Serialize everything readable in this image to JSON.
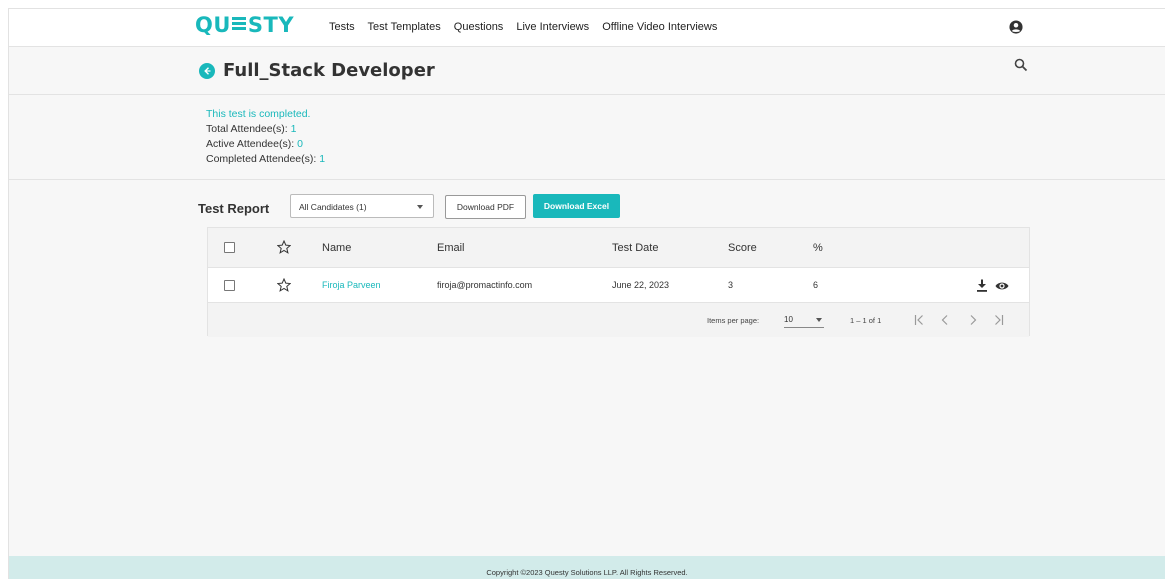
{
  "brand": {
    "logo_left": "QU",
    "logo_right": "STY",
    "accent": "#19b8bb"
  },
  "nav": {
    "items": [
      {
        "label": "Tests"
      },
      {
        "label": "Test Templates"
      },
      {
        "label": "Questions"
      },
      {
        "label": "Live Interviews"
      },
      {
        "label": "Offline Video Interviews"
      }
    ],
    "user_icon": "user-circle-icon"
  },
  "page": {
    "title": "Full_Stack Developer",
    "back_icon": "back-arrow-icon",
    "search_icon": "search-icon"
  },
  "summary": {
    "status": "This test is completed.",
    "total_label": "Total Attendee(s):",
    "total_value": "1",
    "active_label": "Active Attendee(s):",
    "active_value": "0",
    "completed_label": "Completed Attendee(s):",
    "completed_value": "1"
  },
  "report": {
    "label": "Test Report",
    "filter_selected": "All Candidates (1)",
    "download_pdf": "Download PDF",
    "download_excel": "Download Excel"
  },
  "table": {
    "headers": {
      "name": "Name",
      "email": "Email",
      "test_date": "Test Date",
      "score": "Score",
      "percent": "%"
    },
    "rows": [
      {
        "name": "Firoja Parveen",
        "email": "firoja@promactinfo.com",
        "test_date": "June 22, 2023",
        "score": "3",
        "percent": "6"
      }
    ],
    "row_icons": [
      "download-icon",
      "eye-icon"
    ]
  },
  "pagination": {
    "items_per_page_label": "Items per page:",
    "items_per_page_value": "10",
    "range": "1 – 1 of 1"
  },
  "footer": {
    "copyright": "Copyright ©2023 Questy Solutions LLP. All Rights Reserved."
  }
}
